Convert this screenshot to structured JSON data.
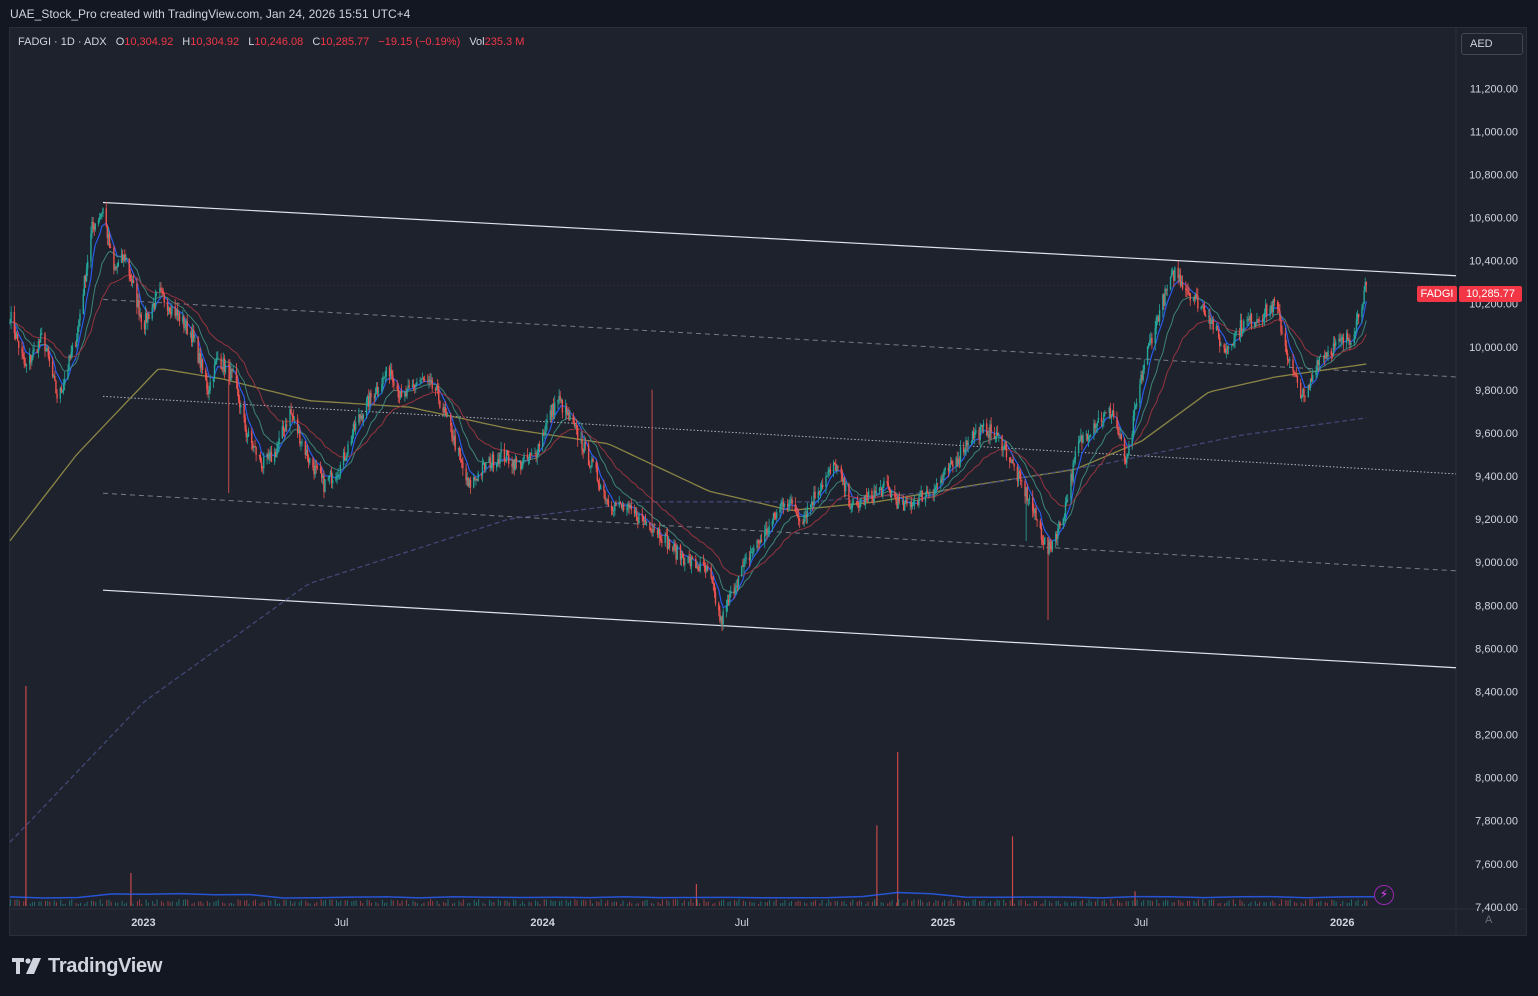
{
  "header": {
    "caption": "UAE_Stock_Pro created with TradingView.com, Jan 24, 2026 15:51 UTC+4"
  },
  "legend": {
    "symbol_line": "FADGI · 1D · ADX",
    "open_label": "O",
    "open": "10,304.92",
    "high_label": "H",
    "high": "10,304.92",
    "low_label": "L",
    "low": "10,246.08",
    "close_label": "C",
    "close": "10,285.77",
    "change": "−19.15 (−0.19%)",
    "vol_label": "Vol",
    "volume": "235.3 M"
  },
  "currency": "AED",
  "last_price": {
    "symbol": "FADGI",
    "value": "10,285.77"
  },
  "footer": {
    "brand": "TradingView",
    "auto_label": "A"
  },
  "colors": {
    "up": "#26a69a",
    "down": "#ef5350",
    "accent": "#f23645",
    "fast_ma": "#2962ff",
    "ma_200": "#8b8545",
    "ma_50": "#a1363f"
  },
  "chart_data": {
    "type": "candlestick",
    "symbol": "FADGI",
    "interval": "1D",
    "exchange": "ADX",
    "y_axis": {
      "ticks": [
        "11,200.00",
        "11,000.00",
        "10,800.00",
        "10,600.00",
        "10,400.00",
        "10,200.00",
        "10,000.00",
        "9,800.00",
        "9,600.00",
        "9,400.00",
        "9,200.00",
        "9,000.00",
        "8,800.00",
        "8,600.00",
        "8,400.00",
        "8,200.00",
        "8,000.00",
        "7,800.00",
        "7,600.00",
        "7,400.00"
      ],
      "tick_values": [
        11200,
        11000,
        10800,
        10600,
        10400,
        10200,
        10000,
        9800,
        9600,
        9400,
        9200,
        9000,
        8800,
        8600,
        8400,
        8200,
        8000,
        7800,
        7600,
        7400
      ],
      "range": [
        7390,
        11480
      ]
    },
    "x_axis": {
      "ticks": [
        "2023",
        "Jul",
        "2024",
        "Jul",
        "2025",
        "Jul",
        "2026"
      ],
      "tick_dates": [
        "2023-01-01",
        "2023-07-01",
        "2024-01-01",
        "2024-07-01",
        "2025-01-01",
        "2025-07-01",
        "2026-01-01"
      ],
      "range": [
        "2022-09-01",
        "2026-04-15"
      ]
    },
    "price_path": [
      [
        "2022-09-01",
        10150
      ],
      [
        "2022-09-15",
        9900
      ],
      [
        "2022-10-01",
        10050
      ],
      [
        "2022-10-15",
        9750
      ],
      [
        "2022-11-01",
        10050
      ],
      [
        "2022-11-15",
        10550
      ],
      [
        "2022-11-25",
        10640
      ],
      [
        "2022-12-05",
        10350
      ],
      [
        "2022-12-15",
        10420
      ],
      [
        "2023-01-01",
        10100
      ],
      [
        "2023-01-15",
        10250
      ],
      [
        "2023-02-01",
        10150
      ],
      [
        "2023-02-15",
        10050
      ],
      [
        "2023-03-01",
        9800
      ],
      [
        "2023-03-10",
        9950
      ],
      [
        "2023-03-25",
        9850
      ],
      [
        "2023-04-05",
        9600
      ],
      [
        "2023-04-20",
        9450
      ],
      [
        "2023-05-01",
        9500
      ],
      [
        "2023-05-15",
        9700
      ],
      [
        "2023-06-01",
        9480
      ],
      [
        "2023-06-15",
        9360
      ],
      [
        "2023-07-01",
        9450
      ],
      [
        "2023-07-15",
        9650
      ],
      [
        "2023-08-01",
        9800
      ],
      [
        "2023-08-15",
        9900
      ],
      [
        "2023-08-25",
        9750
      ],
      [
        "2023-09-10",
        9850
      ],
      [
        "2023-09-25",
        9800
      ],
      [
        "2023-10-10",
        9600
      ],
      [
        "2023-10-25",
        9350
      ],
      [
        "2023-11-10",
        9450
      ],
      [
        "2023-11-25",
        9500
      ],
      [
        "2023-12-10",
        9450
      ],
      [
        "2023-12-25",
        9500
      ],
      [
        "2024-01-05",
        9650
      ],
      [
        "2024-01-15",
        9760
      ],
      [
        "2024-02-01",
        9600
      ],
      [
        "2024-02-15",
        9450
      ],
      [
        "2024-03-01",
        9280
      ],
      [
        "2024-03-15",
        9250
      ],
      [
        "2024-04-01",
        9200
      ],
      [
        "2024-04-15",
        9150
      ],
      [
        "2024-05-01",
        9050
      ],
      [
        "2024-05-15",
        9000
      ],
      [
        "2024-06-01",
        8950
      ],
      [
        "2024-06-12",
        8720
      ],
      [
        "2024-06-25",
        8900
      ],
      [
        "2024-07-10",
        9050
      ],
      [
        "2024-07-25",
        9150
      ],
      [
        "2024-08-10",
        9300
      ],
      [
        "2024-08-25",
        9200
      ],
      [
        "2024-09-10",
        9350
      ],
      [
        "2024-09-25",
        9450
      ],
      [
        "2024-10-10",
        9250
      ],
      [
        "2024-10-25",
        9300
      ],
      [
        "2024-11-10",
        9350
      ],
      [
        "2024-11-25",
        9250
      ],
      [
        "2024-12-10",
        9300
      ],
      [
        "2024-12-25",
        9350
      ],
      [
        "2025-01-10",
        9450
      ],
      [
        "2025-01-25",
        9580
      ],
      [
        "2025-02-10",
        9620
      ],
      [
        "2025-02-25",
        9550
      ],
      [
        "2025-03-10",
        9400
      ],
      [
        "2025-03-20",
        9300
      ],
      [
        "2025-04-07",
        9050
      ],
      [
        "2025-04-20",
        9200
      ],
      [
        "2025-05-05",
        9550
      ],
      [
        "2025-05-20",
        9650
      ],
      [
        "2025-06-05",
        9700
      ],
      [
        "2025-06-18",
        9450
      ],
      [
        "2025-06-25",
        9680
      ],
      [
        "2025-07-05",
        9950
      ],
      [
        "2025-07-20",
        10200
      ],
      [
        "2025-08-01",
        10350
      ],
      [
        "2025-08-15",
        10250
      ],
      [
        "2025-09-01",
        10150
      ],
      [
        "2025-09-15",
        9980
      ],
      [
        "2025-10-01",
        10100
      ],
      [
        "2025-10-20",
        10150
      ],
      [
        "2025-11-01",
        10200
      ],
      [
        "2025-11-15",
        9900
      ],
      [
        "2025-11-28",
        9750
      ],
      [
        "2025-12-10",
        9950
      ],
      [
        "2025-12-25",
        10000
      ],
      [
        "2026-01-10",
        10050
      ],
      [
        "2026-01-23",
        10285.77
      ]
    ],
    "trend_channel": {
      "upper": [
        [
          "2022-11-25",
          10670
        ],
        [
          "2026-04-15",
          10330
        ]
      ],
      "lower": [
        [
          "2022-11-25",
          8870
        ],
        [
          "2026-04-15",
          8510
        ]
      ],
      "mid_upper": [
        [
          "2022-11-25",
          10220
        ],
        [
          "2026-04-15",
          9860
        ]
      ],
      "mid": [
        [
          "2022-11-25",
          9770
        ],
        [
          "2026-04-15",
          9410
        ]
      ],
      "mid_lower": [
        [
          "2022-11-25",
          9320
        ],
        [
          "2026-04-15",
          8960
        ]
      ]
    },
    "moving_averages": [
      {
        "points": [
          [
            "2022-09-01",
            9100
          ],
          [
            "2022-11-01",
            9500
          ],
          [
            "2023-01-15",
            9900
          ],
          [
            "2023-03-15",
            9850
          ],
          [
            "2023-06-01",
            9750
          ],
          [
            "2023-09-01",
            9720
          ],
          [
            "2023-12-01",
            9620
          ],
          [
            "2024-03-01",
            9550
          ],
          [
            "2024-06-01",
            9330
          ],
          [
            "2024-08-15",
            9240
          ],
          [
            "2024-11-01",
            9280
          ],
          [
            "2025-02-01",
            9360
          ],
          [
            "2025-05-01",
            9430
          ],
          [
            "2025-07-01",
            9560
          ],
          [
            "2025-09-01",
            9790
          ],
          [
            "2025-11-01",
            9860
          ],
          [
            "2026-01-23",
            9920
          ]
        ]
      },
      {
        "points": [
          [
            "2022-09-01",
            7700
          ],
          [
            "2023-01-01",
            8350
          ],
          [
            "2023-06-01",
            8900
          ],
          [
            "2023-12-01",
            9200
          ],
          [
            "2024-04-01",
            9280
          ],
          [
            "2024-09-01",
            9280
          ],
          [
            "2025-01-01",
            9330
          ],
          [
            "2025-06-01",
            9460
          ],
          [
            "2025-10-01",
            9590
          ],
          [
            "2026-01-23",
            9670
          ]
        ]
      }
    ],
    "volume": {
      "base_value": 0,
      "spikes": [
        [
          "2022-09-15",
          60
        ],
        [
          "2022-12-20",
          9
        ],
        [
          "2024-05-20",
          6
        ],
        [
          "2024-11-01",
          22
        ],
        [
          "2024-11-20",
          42
        ],
        [
          "2025-03-05",
          19
        ],
        [
          "2025-06-25",
          4
        ]
      ]
    }
  }
}
